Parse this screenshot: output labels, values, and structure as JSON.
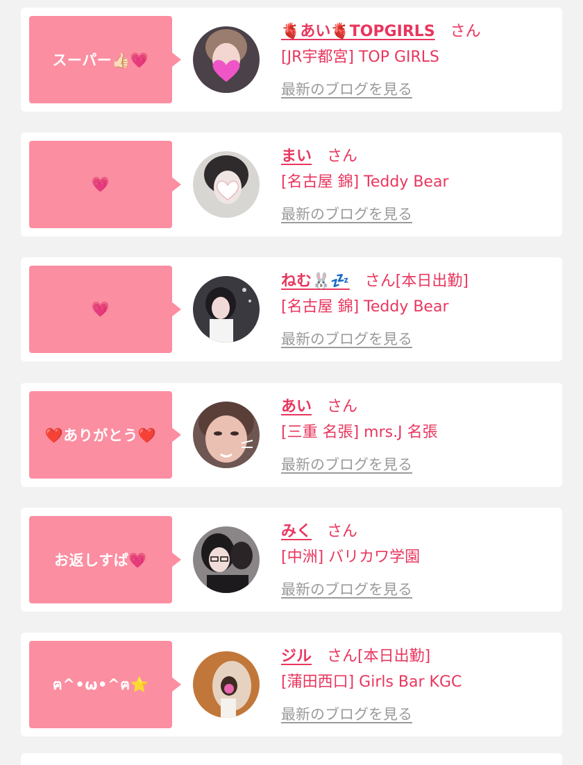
{
  "cards": [
    {
      "comment": "スーパー👍🏻💗",
      "name": "🫀あい🫀TOPGIRLS",
      "honorific": "さん",
      "shop": "[JR宇都宮] TOP GIRLS",
      "blog_link": "最新のブログを見る",
      "avatar_colors": {
        "bg": "#4b4148",
        "face": "#f3d6cf",
        "hair": "#9a7d6e"
      }
    },
    {
      "comment": "💗",
      "name": "まい",
      "honorific": "さん",
      "shop": "[名古屋 錦] Teddy Bear",
      "blog_link": "最新のブログを見る",
      "avatar_colors": {
        "bg": "#d8d6d2",
        "face": "#efe6e4",
        "hair": "#2f2a2b"
      }
    },
    {
      "comment": "💗",
      "name": "ねむ🐰💤",
      "honorific": "さん[本日出勤]",
      "shop": "[名古屋 錦] Teddy Bear",
      "blog_link": "最新のブログを見る",
      "avatar_colors": {
        "bg": "#3a3940",
        "face": "#f1d9d8",
        "hair": "#1e1b20"
      }
    },
    {
      "comment": "❤️ありがとう❤️",
      "name": "あい",
      "honorific": "さん",
      "shop": "[三重 名張] mrs.J 名張",
      "blog_link": "最新のブログを見る",
      "avatar_colors": {
        "bg": "#6e5652",
        "face": "#eac0b2",
        "hair": "#5a3f38"
      }
    },
    {
      "comment": "お返しすぱ💗",
      "name": "みく",
      "honorific": "さん",
      "shop": "[中洲] バリカワ学園",
      "blog_link": "最新のブログを見る",
      "avatar_colors": {
        "bg": "#8a8587",
        "face": "#f0dcd9",
        "hair": "#1d1a1c"
      }
    },
    {
      "comment": "ฅ^•ω•^ฅ⭐",
      "name": "ジル",
      "honorific": "さん[本日出勤]",
      "shop": "[蒲田西口] Girls Bar KGC",
      "blog_link": "最新のブログを見る",
      "avatar_colors": {
        "bg": "#c1773a",
        "face": "#e9c7b0",
        "hair": "#3e2b22"
      }
    }
  ]
}
